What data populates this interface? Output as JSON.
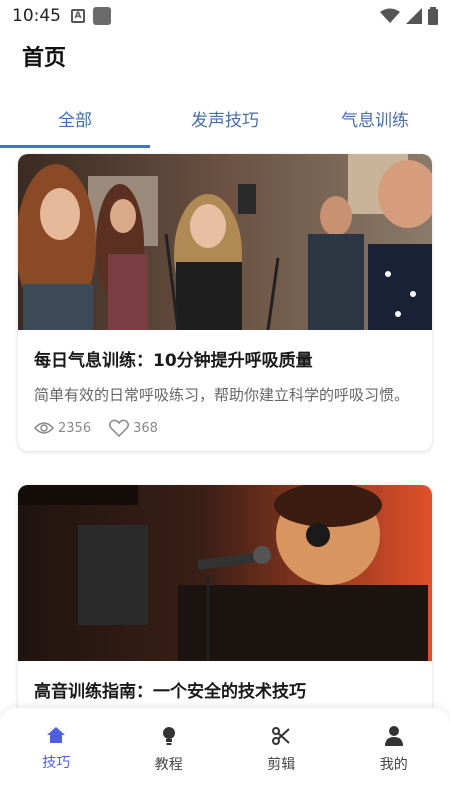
{
  "status_bar": {
    "time": "10:45",
    "app_icon_letter": "A"
  },
  "header": {
    "title": "首页"
  },
  "tabs": [
    {
      "label": "全部",
      "active": true
    },
    {
      "label": "发声技巧",
      "active": false
    },
    {
      "label": "气息训练",
      "active": false
    }
  ],
  "articles": [
    {
      "title": "每日气息训练：10分钟提升呼吸质量",
      "description": "简单有效的日常呼吸练习，帮助你建立科学的呼吸习惯。",
      "views": "2356",
      "likes": "368",
      "image": "choir-singing-photo"
    },
    {
      "title": "高音训练指南：一个安全的技术技巧",
      "description": "",
      "views": "",
      "likes": "",
      "image": "male-singer-microphone-photo"
    }
  ],
  "bottom_nav": [
    {
      "label": "技巧",
      "icon": "home-icon",
      "active": true
    },
    {
      "label": "教程",
      "icon": "lightbulb-icon",
      "active": false
    },
    {
      "label": "剪辑",
      "icon": "scissors-icon",
      "active": false
    },
    {
      "label": "我的",
      "icon": "person-icon",
      "active": false
    }
  ],
  "colors": {
    "accent": "#3f73c4",
    "nav_active": "#4d5ee0"
  }
}
